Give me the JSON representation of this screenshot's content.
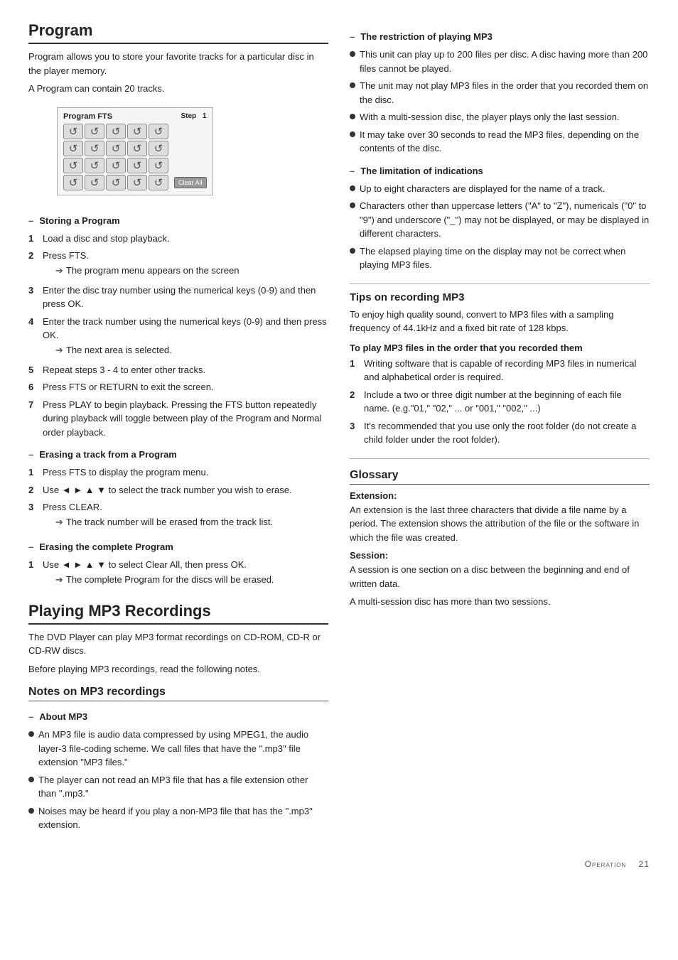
{
  "left": {
    "program_section": {
      "title": "Program",
      "intro": [
        "Program allows you to store your favorite tracks for a particular disc in the player memory.",
        "A Program can contain 20 tracks."
      ],
      "fts_box": {
        "label": "Program FTS",
        "step_label": "Step",
        "step_value": "1",
        "clear_all": "Clear All",
        "rows": 4,
        "cols": 5
      },
      "storing_heading": "Storing a Program",
      "storing_steps": [
        {
          "num": "1",
          "text": "Load a disc and stop playback."
        },
        {
          "num": "2",
          "text": "Press FTS.",
          "arrow": "The program menu appears on the screen"
        },
        {
          "num": "3",
          "text": "Enter the disc tray number using the numerical keys (0-9) and then press OK."
        },
        {
          "num": "4",
          "text": "Enter the track number using the numerical keys (0-9) and then press OK.",
          "arrow": "The next area is selected."
        },
        {
          "num": "5",
          "text": "Repeat steps 3 - 4 to enter other tracks."
        },
        {
          "num": "6",
          "text": "Press FTS or RETURN to exit the screen."
        },
        {
          "num": "7",
          "text": "Press PLAY to begin playback. Pressing the FTS button repeatedly during playback will toggle between play of the Program and Normal order playback."
        }
      ],
      "erasing_track_heading": "Erasing a track from a Program",
      "erasing_track_steps": [
        {
          "num": "1",
          "text": "Press FTS to display the program menu."
        },
        {
          "num": "2",
          "text": "Use ◄ ► ▲ ▼ to select the track number you wish to erase."
        },
        {
          "num": "3",
          "text": "Press CLEAR.",
          "arrow": "The track number will be erased from the track list."
        }
      ],
      "erasing_complete_heading": "Erasing the complete Program",
      "erasing_complete_steps": [
        {
          "num": "1",
          "text": "Use ◄ ► ▲ ▼ to select Clear All, then press OK.",
          "arrow": "The complete Program for the discs will be erased."
        }
      ]
    },
    "mp3_section": {
      "title": "Playing MP3 Recordings",
      "intro": [
        "The DVD Player can play MP3 format recordings on CD-ROM, CD-R or CD-RW discs.",
        "Before playing MP3 recordings, read the following notes."
      ],
      "notes_heading": "Notes on MP3 recordings",
      "about_mp3_heading": "About MP3",
      "about_mp3_bullets": [
        "An MP3 file is audio data compressed by using MPEG1, the audio layer-3 file-coding scheme. We call files that have the \".mp3\" file extension \"MP3 files.\"",
        "The player can not read an MP3 file that has a file extension other than \".mp3.\"",
        "Noises may be heard if you play a non-MP3 file that has the \".mp3\" extension."
      ]
    }
  },
  "right": {
    "restriction_heading": "The restriction of playing MP3",
    "restriction_bullets": [
      "This unit can play up to 200 files per disc. A disc having more than 200 files cannot be played.",
      "The unit may not play MP3 files in the order that you recorded them on the disc.",
      "With a multi-session disc, the player plays only the last session.",
      "It may take over 30 seconds to read the MP3 files, depending on the contents of the disc."
    ],
    "limitation_heading": "The limitation of indications",
    "limitation_bullets": [
      "Up to eight characters are displayed for the name of a track.",
      "Characters other than uppercase letters (\"A\" to \"Z\"), numericals (\"0\" to \"9\") and underscore (\"_\") may not be displayed, or may be displayed in different characters.",
      "The elapsed playing time on the display may not be correct when playing MP3 files."
    ],
    "tips_heading": "Tips on recording MP3",
    "tips_intro": "To enjoy high quality sound, convert to MP3 files with a sampling frequency of 44.1kHz and a fixed bit rate of 128 kbps.",
    "to_play_heading": "To play MP3 files in the order that you recorded them",
    "to_play_steps": [
      {
        "num": "1",
        "text": "Writing software that is capable of recording MP3 files in numerical and alphabetical order is required."
      },
      {
        "num": "2",
        "text": "Include a two or three digit number at the beginning of each file name. (e.g.\"01,\" \"02,\" ... or \"001,\" \"002,\" ...)"
      },
      {
        "num": "3",
        "text": "It's recommended that you use only the root folder (do not create a child folder under the root folder)."
      }
    ],
    "glossary_heading": "Glossary",
    "glossary_items": [
      {
        "term": "Extension:",
        "def": "An extension is the last three characters that divide a file name by a period. The extension shows the attribution of the file or the software in which the file was created."
      },
      {
        "term": "Session:",
        "def1": "A session is one section on a disc between the beginning and end of written data.",
        "def2": "A multi-session disc has more than two sessions."
      }
    ]
  },
  "footer": {
    "label": "Operation",
    "page": "21"
  }
}
